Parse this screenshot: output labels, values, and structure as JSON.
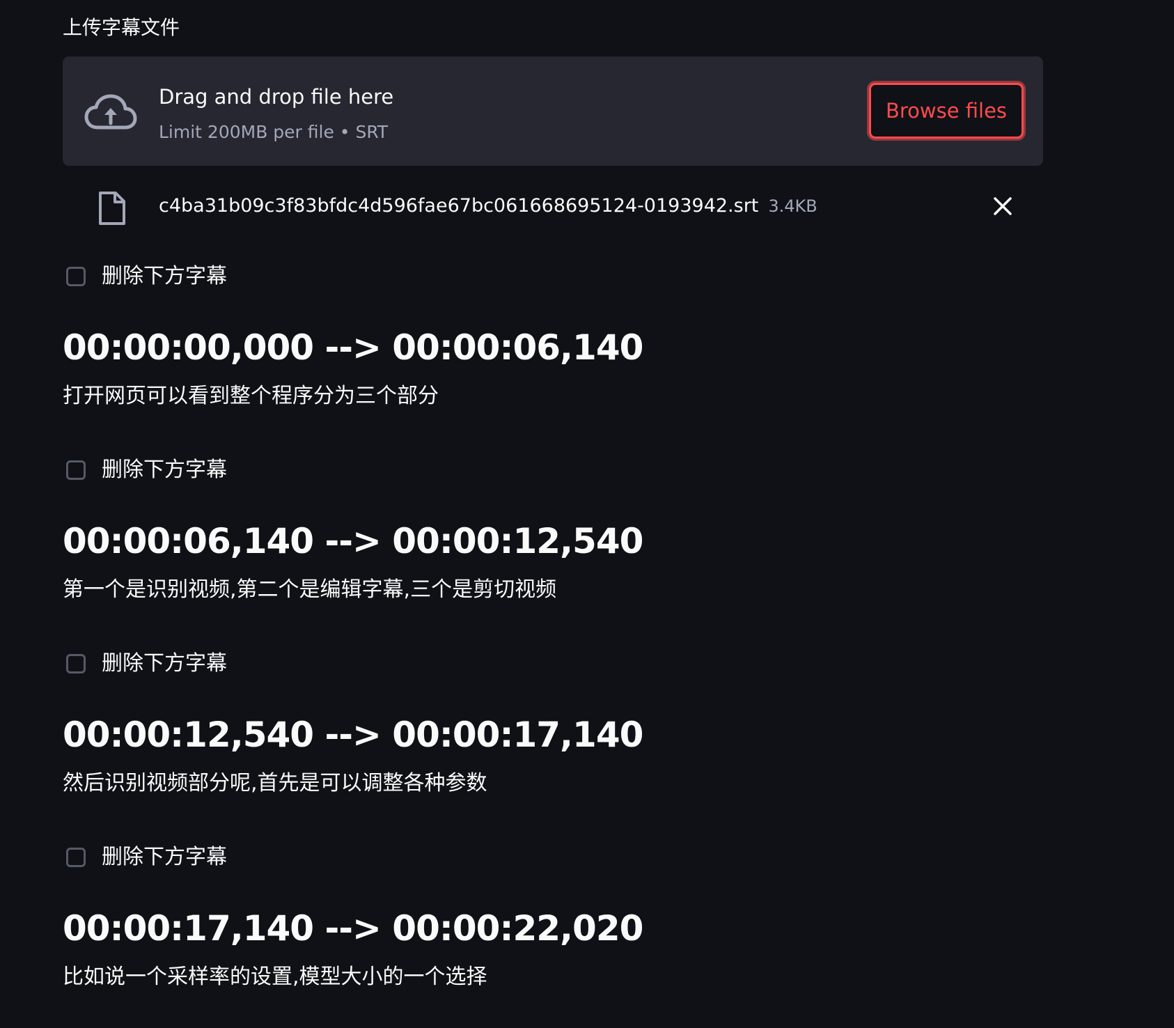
{
  "uploader": {
    "label": "上传字幕文件",
    "drop_title": "Drag and drop file here",
    "drop_limit": "Limit 200MB per file • SRT",
    "browse_label": "Browse files",
    "cloud_icon": "cloud-upload-icon"
  },
  "uploaded_file": {
    "name": "c4ba31b09c3f83bfdc4d596fae67bc061668695124-0193942.srt",
    "size": "3.4KB",
    "file_icon": "file-icon",
    "close_icon": "close-icon"
  },
  "entries": [
    {
      "checkbox_label": "删除下方字幕",
      "checked": false,
      "timecode": "00:00:00,000 --> 00:00:06,140",
      "text": "打开网页可以看到整个程序分为三个部分"
    },
    {
      "checkbox_label": "删除下方字幕",
      "checked": false,
      "timecode": "00:00:06,140 --> 00:00:12,540",
      "text": "第一个是识别视频,第二个是编辑字幕,三个是剪切视频"
    },
    {
      "checkbox_label": "删除下方字幕",
      "checked": false,
      "timecode": "00:00:12,540 --> 00:00:17,140",
      "text": "然后识别视频部分呢,首先是可以调整各种参数"
    },
    {
      "checkbox_label": "删除下方字幕",
      "checked": false,
      "timecode": "00:00:17,140 --> 00:00:22,020",
      "text": "比如说一个采样率的设置,模型大小的一个选择"
    }
  ],
  "colors": {
    "background": "#0f1117",
    "dropzone": "#262730",
    "accent": "#ff4b4b",
    "muted_text": "#a3a8b8",
    "text": "#fafafa"
  }
}
